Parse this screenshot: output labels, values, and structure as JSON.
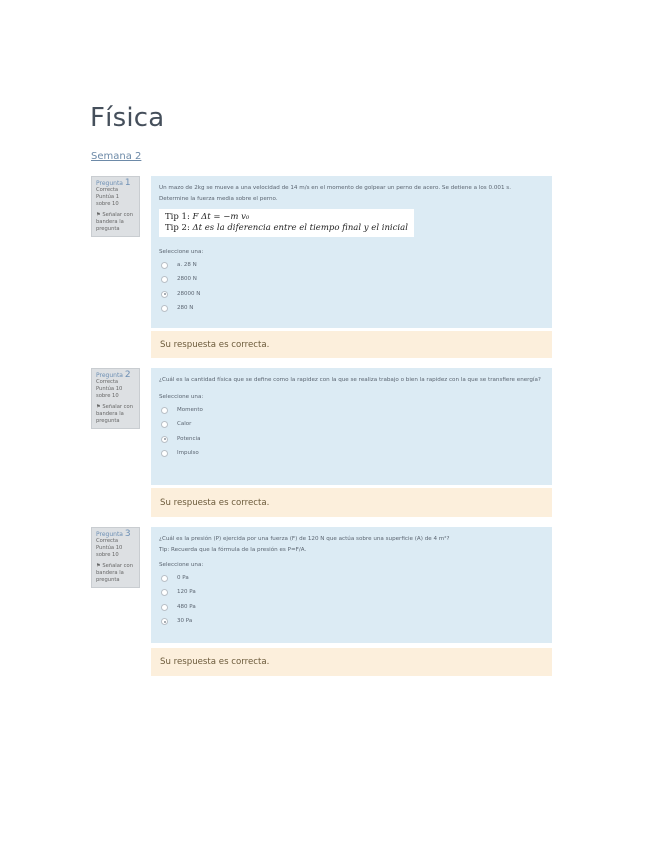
{
  "page": {
    "title": "Física",
    "section_link": "Semana 2"
  },
  "questions": [
    {
      "info": {
        "label": "Pregunta",
        "number": "1",
        "state": "Correcta",
        "mark": "Puntúa 1 sobre 10",
        "flag": "Señalar con bandera la pregunta"
      },
      "text": "Un mazo de 2kg se mueve a una velocidad de 14 m/s en el momento de golpear un perno de acero. Se detiene a los 0.001 s.",
      "text2": "Determine la fuerza media sobre el perno.",
      "tips": [
        {
          "label": "Tip 1:",
          "formula": "F Δt = −m v₀"
        },
        {
          "label": "Tip 2:",
          "formula": "Δt es la diferencia entre el tiempo final y el inicial"
        }
      ],
      "prompt": "Seleccione una:",
      "options": [
        {
          "label": "a. 28 N",
          "checked": false
        },
        {
          "label": "2800 N",
          "checked": false
        },
        {
          "label": "28000 N",
          "checked": true
        },
        {
          "label": "280 N",
          "checked": false
        }
      ],
      "feedback": "Su respuesta es correcta."
    },
    {
      "info": {
        "label": "Pregunta",
        "number": "2",
        "state": "Correcta",
        "mark": "Puntúa 10 sobre 10",
        "flag": "Señalar con bandera la pregunta"
      },
      "text": "¿Cuál es la cantidad física que se define como la rapidez con la que se realiza trabajo o bien la rapidez con la que se transfiere energía?",
      "prompt": "Seleccione una:",
      "options": [
        {
          "label": "Momento",
          "checked": false
        },
        {
          "label": "Calor",
          "checked": false
        },
        {
          "label": "Potencia",
          "checked": true
        },
        {
          "label": "Impulso",
          "checked": false
        }
      ],
      "feedback": "Su respuesta es correcta."
    },
    {
      "info": {
        "label": "Pregunta",
        "number": "3",
        "state": "Correcta",
        "mark": "Puntúa 10 sobre 10",
        "flag": "Señalar con bandera la pregunta"
      },
      "text": "¿Cuál es la presión (P) ejercida por una fuerza (F) de 120 N que actúa sobre una superficie (A) de 4 m²?",
      "text2": "Tip: Recuerda que la fórmula de la presión es P=F/A.",
      "prompt": "Seleccione una:",
      "options": [
        {
          "label": "0 Pa",
          "checked": false
        },
        {
          "label": "120 Pa",
          "checked": false
        },
        {
          "label": "480 Pa",
          "checked": false
        },
        {
          "label": "30 Pa",
          "checked": true
        }
      ],
      "feedback": "Su respuesta es correcta."
    }
  ]
}
